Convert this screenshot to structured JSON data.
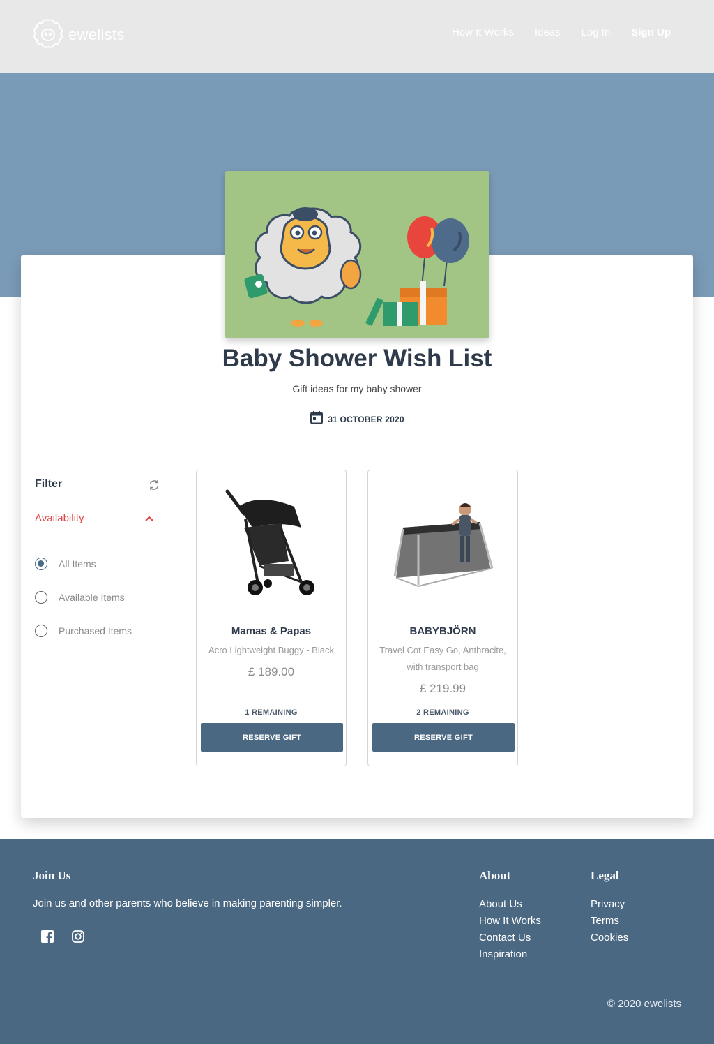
{
  "header": {
    "logo_text": "ewelists",
    "nav": {
      "how_it_works": "How It Works",
      "ideas": "Ideas",
      "login": "Log In",
      "signup": "Sign Up"
    }
  },
  "list": {
    "title": "Baby Shower Wish List",
    "subtitle": "Gift ideas for my baby shower",
    "date": "31 OCTOBER 2020"
  },
  "filter": {
    "title": "Filter",
    "section_label": "Availability",
    "options": [
      {
        "label": "All Items",
        "checked": true
      },
      {
        "label": "Available Items",
        "checked": false
      },
      {
        "label": "Purchased Items",
        "checked": false
      }
    ]
  },
  "products": [
    {
      "brand": "Mamas & Papas",
      "description": "Acro Lightweight Buggy - Black",
      "price": "£ 189.00",
      "remaining": "1 REMAINING",
      "button": "RESERVE GIFT",
      "image_icon": "stroller-icon"
    },
    {
      "brand": "BABYBJÖRN",
      "description": "Travel Cot Easy Go, Anthracite, with transport bag",
      "price": "£ 219.99",
      "remaining": "2 REMAINING",
      "button": "RESERVE GIFT",
      "image_icon": "travel-cot-icon"
    }
  ],
  "footer": {
    "join_heading": "Join Us",
    "join_text": "Join us and other parents who believe in making parenting simpler.",
    "about_heading": "About",
    "about_links": [
      "About Us",
      "How It Works",
      "Contact Us",
      "Inspiration"
    ],
    "legal_heading": "Legal",
    "legal_links": [
      "Privacy",
      "Terms",
      "Cookies"
    ],
    "copyright": "© 2020 ewelists"
  },
  "colors": {
    "header_bg": "#e8e8e8",
    "hero_bg": "#7a9bb8",
    "footer_bg": "#4b6882",
    "button_bg": "#4b6882",
    "accent_red": "#e04545",
    "cover_bg": "#a2c585"
  }
}
